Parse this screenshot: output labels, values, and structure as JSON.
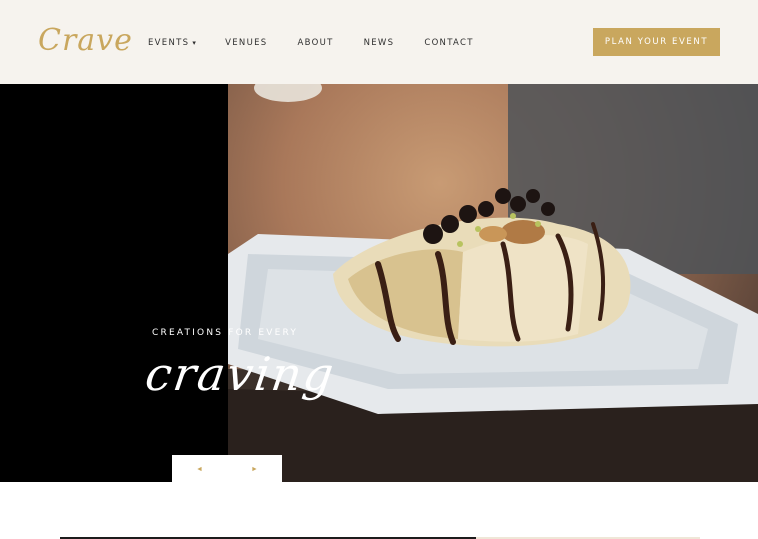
{
  "brand": {
    "logo_text": "Crave"
  },
  "nav": {
    "items": [
      {
        "label": "EVENTS",
        "caret": "▾"
      },
      {
        "label": "VENUES"
      },
      {
        "label": "ABOUT"
      },
      {
        "label": "NEWS"
      },
      {
        "label": "CONTACT"
      }
    ]
  },
  "cta": {
    "label": "PLAN YOUR EVENT"
  },
  "hero": {
    "tagline_small": "CREATIONS FOR EVERY",
    "tagline_script": "craving"
  },
  "slider": {
    "prev_icon": "◄",
    "next_icon": "►"
  },
  "colors": {
    "accent_gold": "#c9a75e",
    "header_bg": "#f6f3ee",
    "hero_left_bg": "#000000"
  }
}
